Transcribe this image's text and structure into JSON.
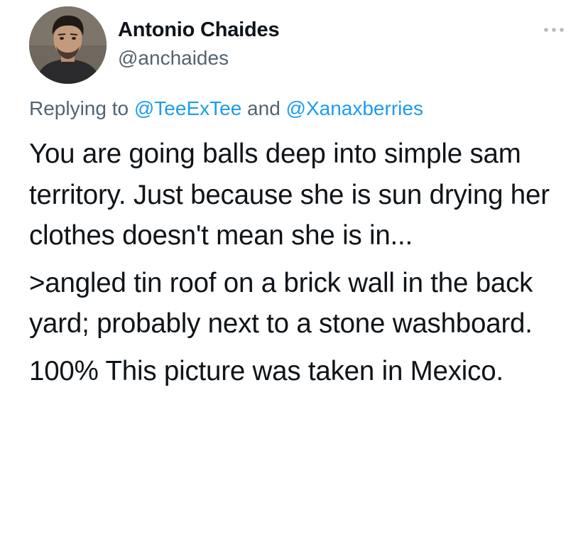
{
  "tweet": {
    "author": {
      "display_name": "Antonio Chaides",
      "handle": "@anchaides",
      "avatar_icon": "profile-photo-avatar"
    },
    "more_icon": "more-options-ellipsis-icon",
    "reply_context": {
      "prefix": "Replying to",
      "users": [
        "@TeeExTee",
        "@Xanaxberries"
      ],
      "conjunction": "and"
    },
    "paragraphs": [
      "You are going balls deep into simple sam territory. Just because she is sun drying her clothes doesn't mean she is in...",
      ">angled tin roof on a brick wall in the back yard; probably next to a stone washboard.",
      "100% This picture was taken in Mexico."
    ]
  },
  "colors": {
    "text_primary": "#0f1419",
    "text_secondary": "#536471",
    "link": "#1d9bf0"
  }
}
